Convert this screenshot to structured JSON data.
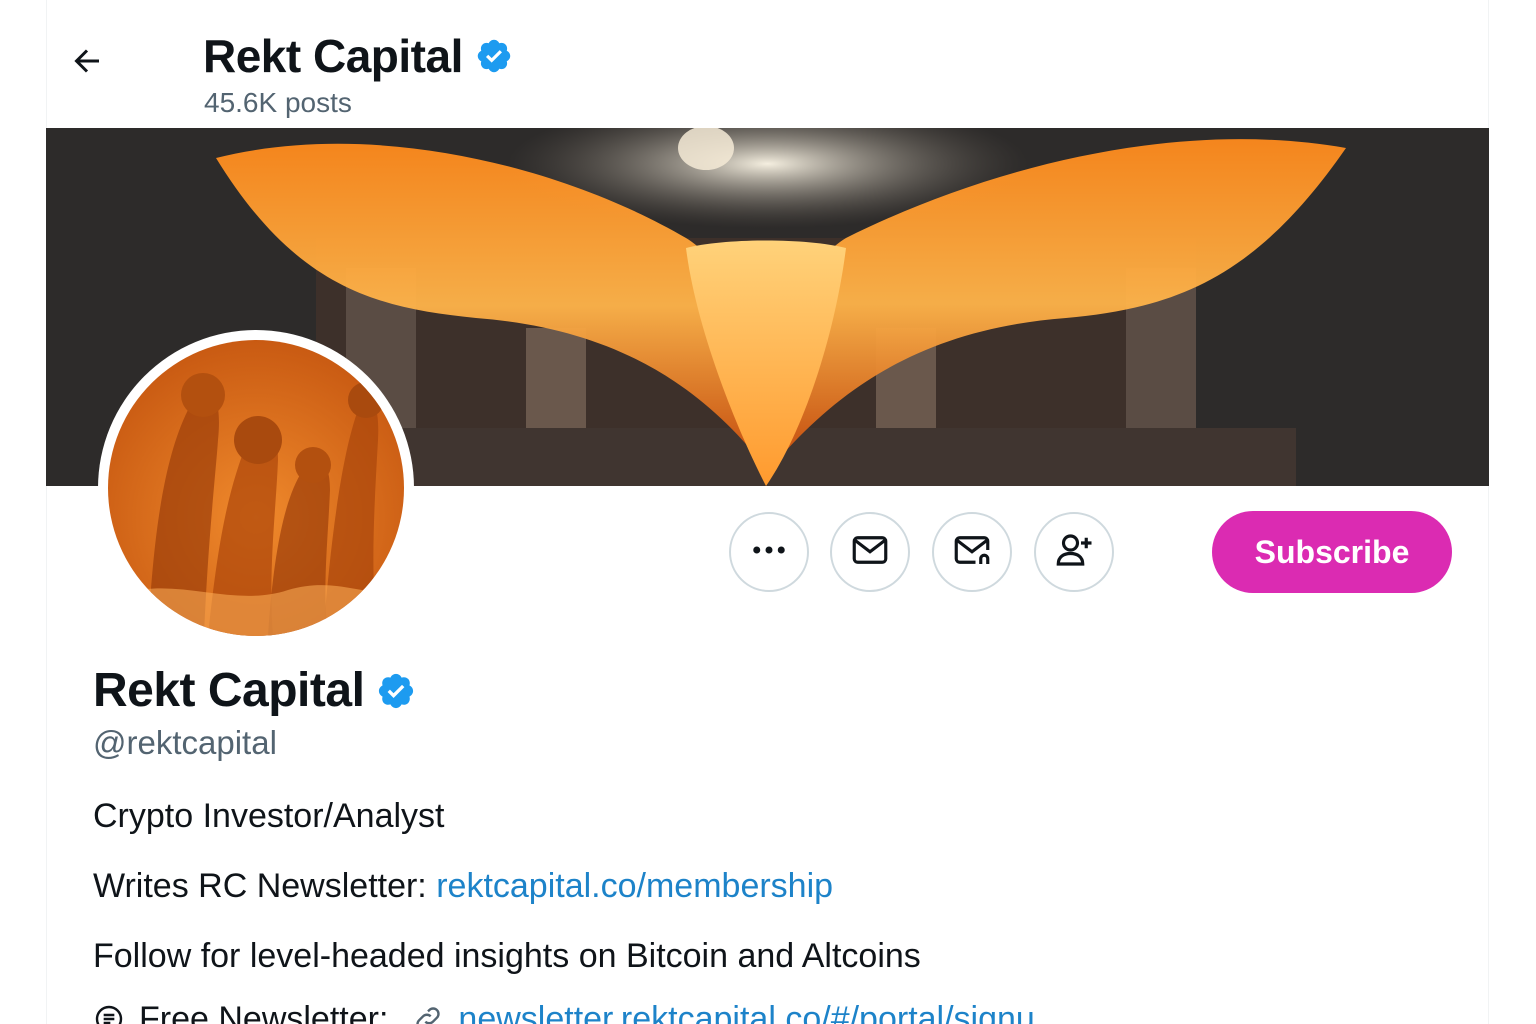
{
  "header": {
    "back_icon": "arrow-left-icon",
    "title": "Rekt Capital",
    "posts_count": "45.6K posts",
    "verified_color": "#1d9bf0"
  },
  "actions": {
    "more_icon": "more-horizontal-icon",
    "message_icon": "mail-icon",
    "subscribe_notify_icon": "mail-bell-icon",
    "follow_icon": "person-add-icon",
    "subscribe_label": "Subscribe",
    "subscribe_color": "#db2bb2"
  },
  "profile": {
    "name": "Rekt Capital",
    "handle": "@rektcapital",
    "bio": {
      "line1": "Crypto Investor/Analyst",
      "line2_prefix": "Writes RC Newsletter:",
      "line2_link": "rektcapital.co/membership",
      "line3": "Follow for level-headed insights on Bitcoin and Altcoins",
      "line4_prefix": "Free Newsletter:",
      "line4_link": "newsletter.rektcapital.co/#/portal/signu"
    },
    "link_color": "#1d83c9"
  }
}
